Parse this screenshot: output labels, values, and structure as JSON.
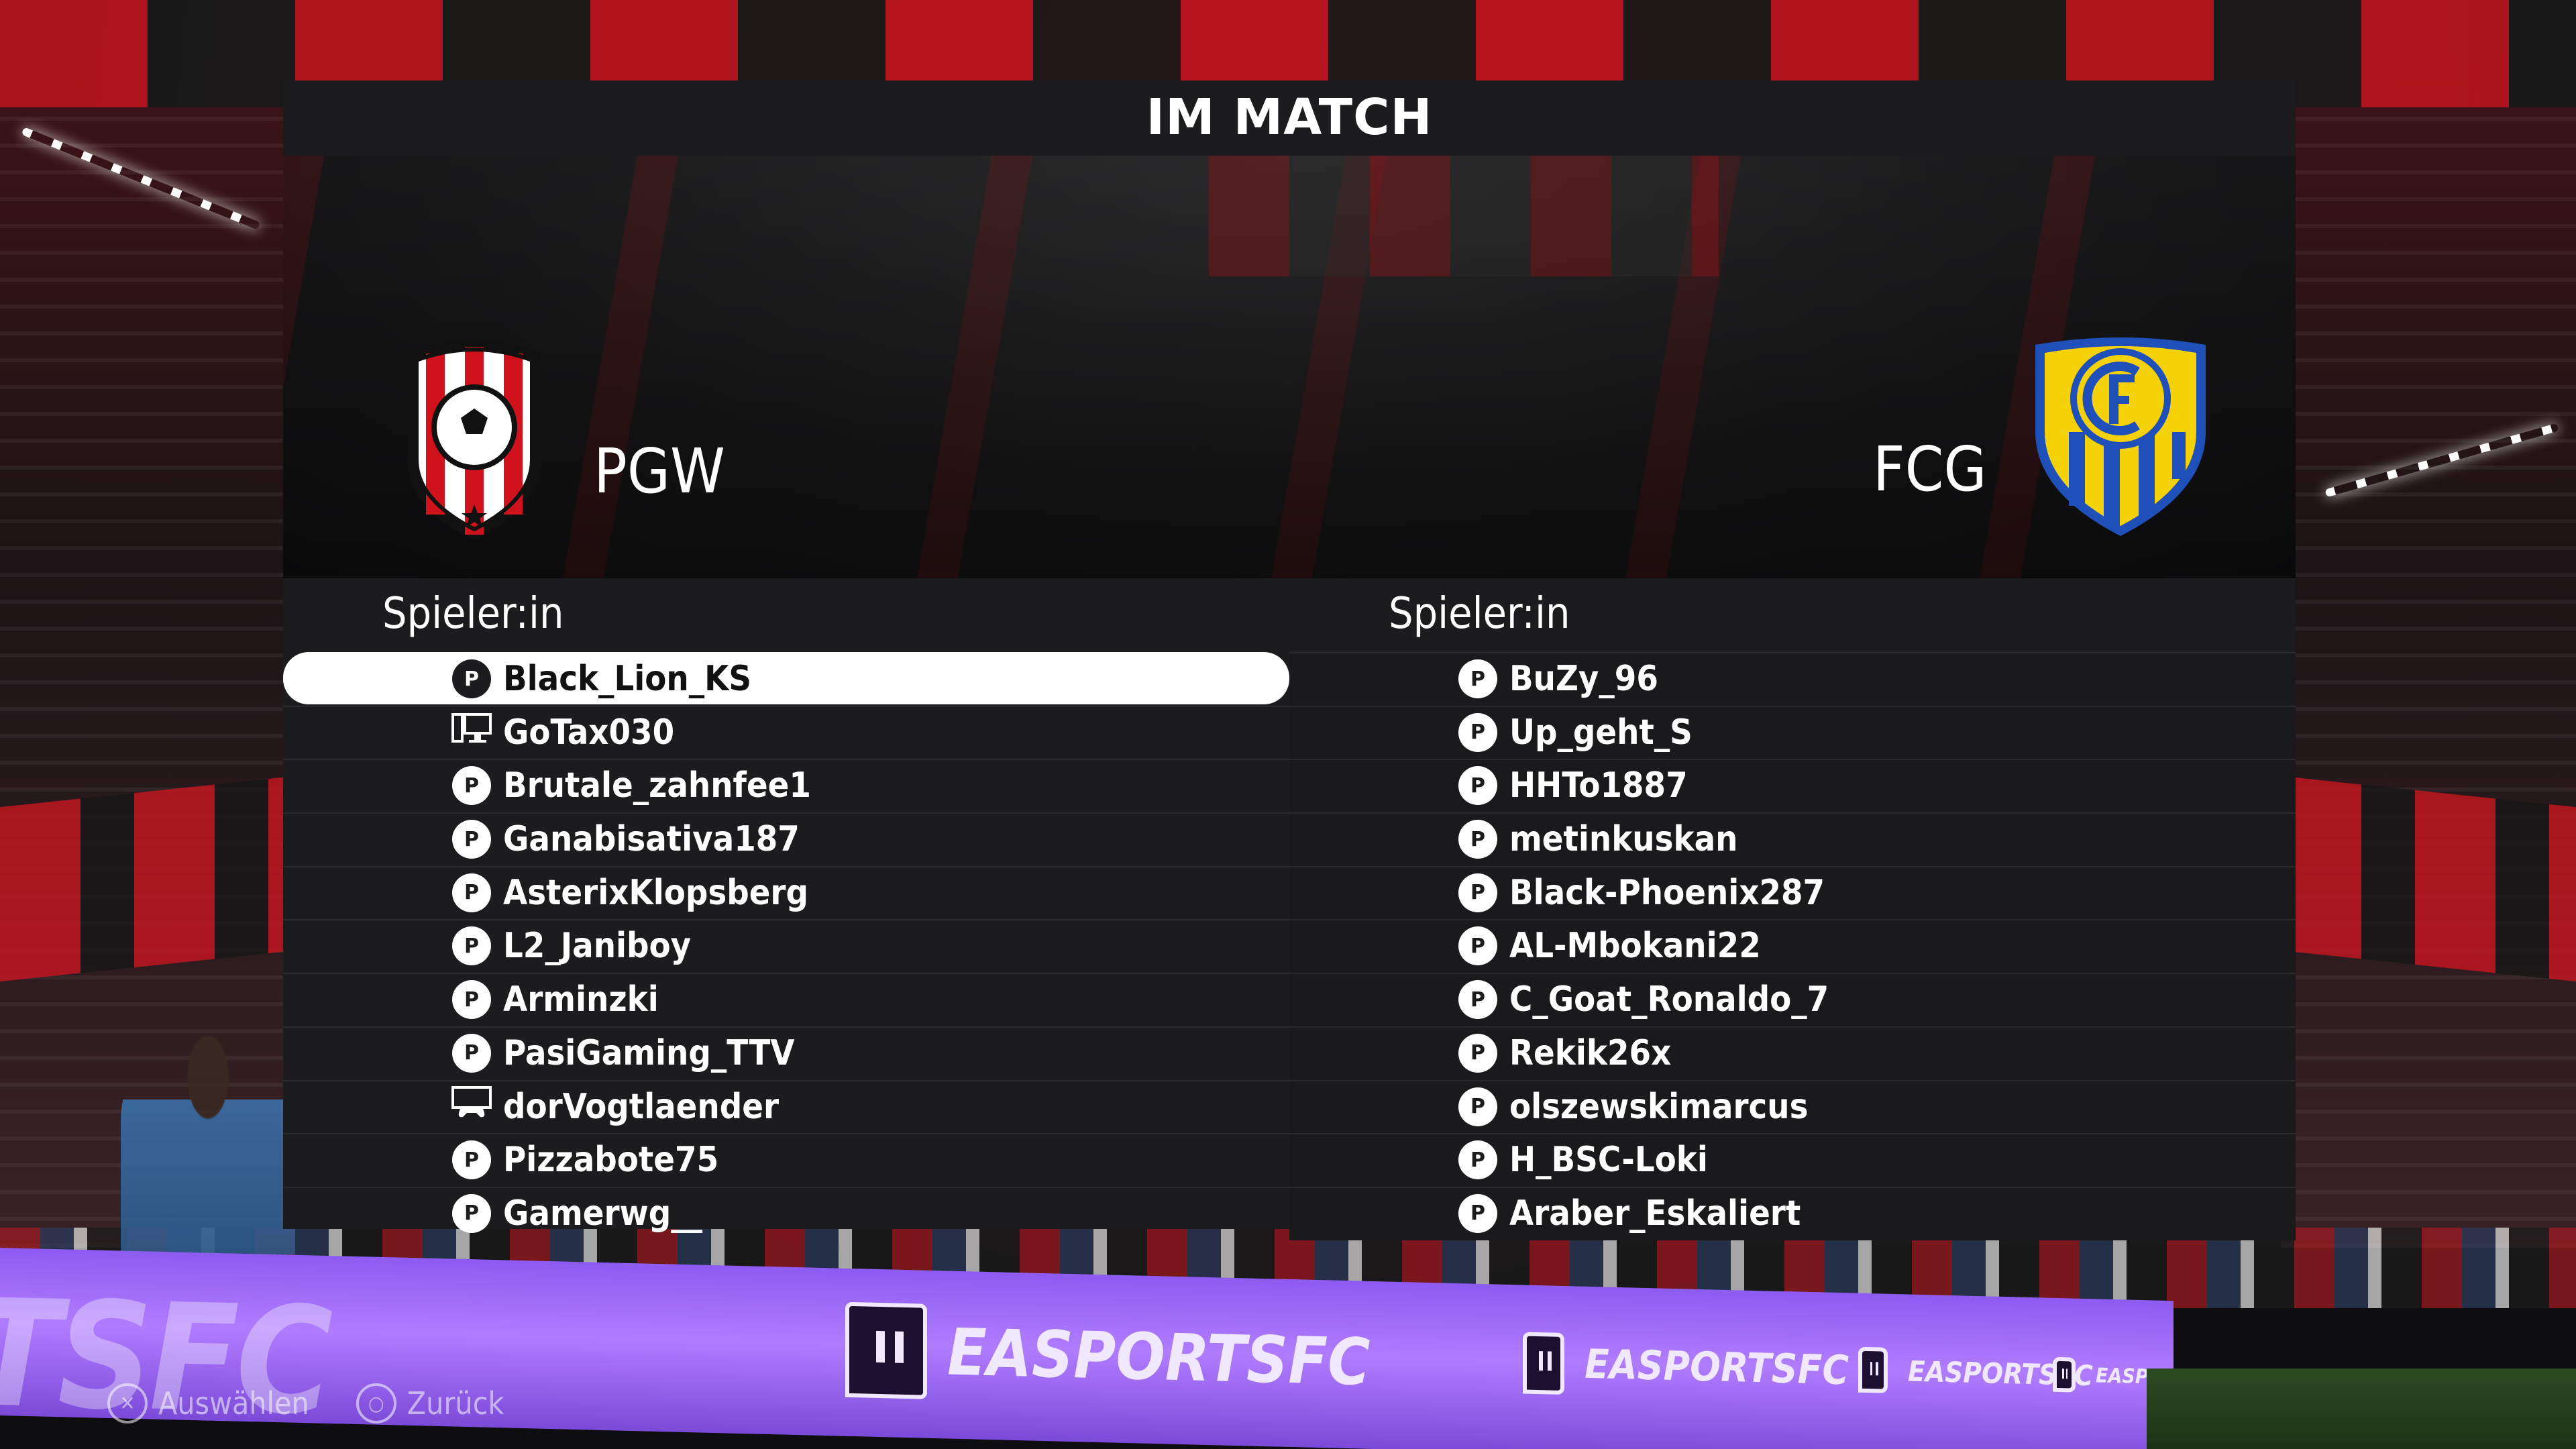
{
  "screen": {
    "title": "IM MATCH"
  },
  "home_team": {
    "abbr": "PGW",
    "crest": "red-black-striped-shield-with-football"
  },
  "away_team": {
    "abbr": "FCG",
    "crest": "yellow-blue-striped-shield-with-FC-monogram"
  },
  "home_players": {
    "header": "Spieler:in",
    "items": [
      {
        "name": "Black_Lion_KS",
        "platform": "playstation",
        "selected": true
      },
      {
        "name": "GoTax030",
        "platform": "pc"
      },
      {
        "name": "Brutale_zahnfee1",
        "platform": "playstation"
      },
      {
        "name": "Ganabisativa187",
        "platform": "playstation"
      },
      {
        "name": "AsterixKlopsberg",
        "platform": "playstation"
      },
      {
        "name": "L2_Janiboy",
        "platform": "playstation"
      },
      {
        "name": "Arminzki",
        "platform": "playstation"
      },
      {
        "name": "PasiGaming_TTV",
        "platform": "playstation"
      },
      {
        "name": "dorVogtlaender",
        "platform": "console"
      },
      {
        "name": "Pizzabote75",
        "platform": "playstation"
      },
      {
        "name": "Gamerwg__",
        "platform": "playstation"
      }
    ]
  },
  "away_players": {
    "header": "Spieler:in",
    "items": [
      {
        "name": "BuZy_96",
        "platform": "playstation"
      },
      {
        "name": "Up_geht_S",
        "platform": "playstation"
      },
      {
        "name": "HHTo1887",
        "platform": "playstation"
      },
      {
        "name": "metinkuskan",
        "platform": "playstation"
      },
      {
        "name": "Black-Phoenix287",
        "platform": "playstation"
      },
      {
        "name": "AL-Mbokani22",
        "platform": "playstation"
      },
      {
        "name": "C_Goat_Ronaldo_7",
        "platform": "playstation"
      },
      {
        "name": "Rekik26x",
        "platform": "playstation"
      },
      {
        "name": "olszewskimarcus",
        "platform": "playstation"
      },
      {
        "name": "H_BSC-Loki",
        "platform": "playstation"
      },
      {
        "name": "Araber_Eskaliert",
        "platform": "playstation"
      }
    ]
  },
  "hints": {
    "select": {
      "label": "Auswählen",
      "icon": "cross-button-icon"
    },
    "back": {
      "label": "Zurück",
      "icon": "circle-button-icon"
    }
  },
  "background": {
    "led_word_large": "RTSFC",
    "led_brand": "EASPORTSFC"
  },
  "colors": {
    "panel": "#1c1c1e",
    "selected_row": "#ffffff",
    "led_purple": "#9b68ff",
    "home_red": "#d0121c",
    "away_yellow": "#f5d10a",
    "away_blue": "#1f4fb8"
  }
}
